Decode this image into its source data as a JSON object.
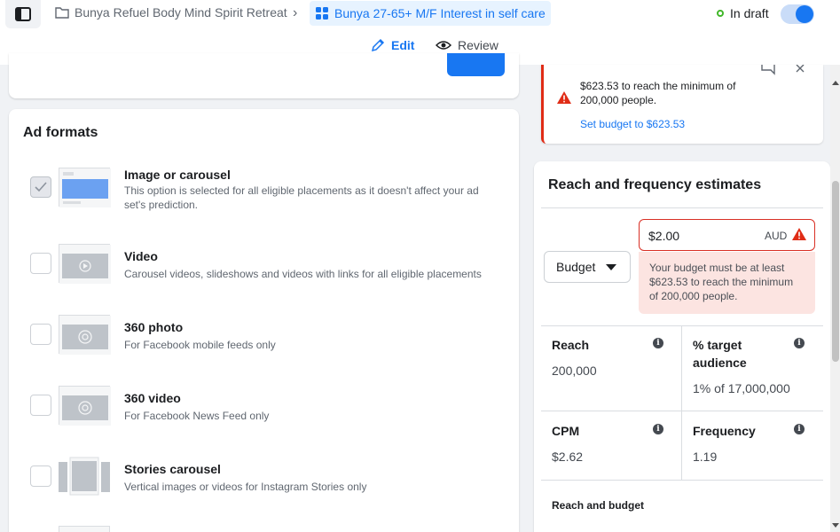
{
  "header": {
    "campaign_name": "Bunya Refuel Body Mind Spirit Retreat",
    "separator": "›",
    "adset_name": "Bunya 27-65+ M/F Interest in self care",
    "status": "In draft",
    "accent": "#1877f2"
  },
  "tabs": [
    {
      "label": "Edit",
      "active": true,
      "icon": "pencil-icon"
    },
    {
      "label": "Review",
      "active": false,
      "icon": "eye-icon"
    }
  ],
  "ad_formats": {
    "title": "Ad formats",
    "items": [
      {
        "label": "Image or carousel",
        "description": "This option is selected for all eligible placements as it doesn't affect your ad set's prediction.",
        "checked": true
      },
      {
        "label": "Video",
        "description": "Carousel videos, slideshows and videos with links for all eligible placements",
        "checked": false
      },
      {
        "label": "360 photo",
        "description": "For Facebook mobile feeds only",
        "checked": false
      },
      {
        "label": "360 video",
        "description": "For Facebook News Feed only",
        "checked": false
      },
      {
        "label": "Stories carousel",
        "description": "Vertical images or videos for Instagram Stories only",
        "checked": false
      }
    ]
  },
  "alert": {
    "text": "$623.53 to reach the minimum of 200,000 people.",
    "link": "Set budget to $623.53",
    "color": "#e02c16"
  },
  "reach_frequency": {
    "title": "Reach and frequency estimates",
    "budget_type": "Budget",
    "budget_value": "$2.00",
    "currency": "AUD",
    "budget_error": "Your budget must be at least $623.53 to reach the minimum of 200,000 people.",
    "metrics": {
      "reach_label": "Reach",
      "reach_value": "200,000",
      "target_label": "% target audience",
      "target_value": "1% of 17,000,000",
      "cpm_label": "CPM",
      "cpm_value": "$2.62",
      "frequency_label": "Frequency",
      "frequency_value": "1.19"
    },
    "reach_budget_title": "Reach and budget"
  }
}
